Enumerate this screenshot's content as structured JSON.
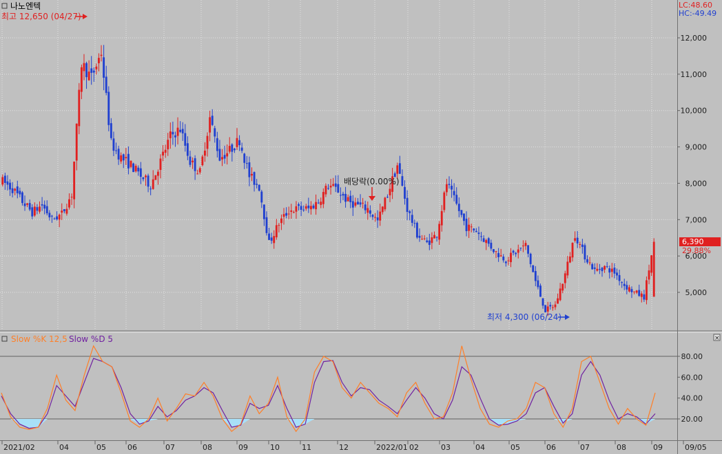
{
  "stock_name": "나노엔텍",
  "lc_label": "LC:48.60",
  "hc_label": "HC:-49.49",
  "high_annotation": "최고 12,650 (04/27)",
  "low_annotation": "최저 4,300 (06/24)",
  "ex_dividend_label": "배당락(0.00%)",
  "current_price_label": "6,390",
  "change_pct_label": "29.88%",
  "indicator_k_label": "Slow %K 12,5",
  "indicator_d_label": "Slow %D 5",
  "collapse_glyph": "×",
  "colors": {
    "up": "#e02020",
    "down": "#2040d0",
    "slow_k": "#ff7f27",
    "slow_d": "#7020a0",
    "oversold_fill": "#a8e0f8"
  },
  "chart_data": [
    {
      "type": "candlestick",
      "title": "나노엔텍",
      "y_ticks": [
        5000,
        6000,
        7000,
        8000,
        9000,
        10000,
        11000,
        12000
      ],
      "ylim": [
        4000,
        12900
      ],
      "x_ticks": [
        "2021/02",
        "04",
        "05",
        "06",
        "07",
        "08",
        "09",
        "10",
        "11",
        "12",
        "2022/01",
        "02",
        "03",
        "04",
        "05",
        "06",
        "07",
        "08",
        "09",
        "09/05"
      ],
      "approx_close_series": [
        8050,
        7850,
        7500,
        7200,
        7400,
        7000,
        7150,
        7700,
        11300,
        10900,
        11600,
        9100,
        8700,
        8500,
        8200,
        7950,
        8600,
        9300,
        9500,
        8600,
        8300,
        9800,
        8700,
        8900,
        9200,
        8200,
        7900,
        6350,
        6900,
        7250,
        7300,
        7300,
        7500,
        7950,
        7800,
        7500,
        7400,
        7300,
        6950,
        7700,
        8500,
        7300,
        6600,
        6350,
        6600,
        8000,
        7400,
        6800,
        6700,
        6400,
        6100,
        5900,
        6100,
        6300,
        5300,
        4500,
        4650,
        5500,
        6600,
        6000,
        5600,
        5700,
        5550,
        5200,
        5000,
        4880,
        6390
      ],
      "high": {
        "value": 12650,
        "date": "04/27"
      },
      "low": {
        "value": 4300,
        "date": "06/24"
      },
      "last": 6390,
      "change_pct": 29.88
    },
    {
      "type": "line",
      "title": "Slow %K 12,5 / Slow %D 5",
      "y_ticks": [
        20,
        40,
        60,
        80
      ],
      "ylim": [
        0,
        95
      ],
      "reference_lines": [
        20,
        80
      ],
      "series": [
        {
          "name": "Slow %K 12,5",
          "values": [
            45,
            22,
            12,
            10,
            12,
            30,
            62,
            38,
            28,
            62,
            90,
            75,
            70,
            45,
            18,
            12,
            20,
            40,
            18,
            30,
            44,
            42,
            55,
            42,
            20,
            8,
            15,
            42,
            25,
            35,
            60,
            22,
            8,
            20,
            65,
            80,
            75,
            50,
            40,
            55,
            45,
            35,
            30,
            22,
            45,
            55,
            35,
            20,
            22,
            45,
            90,
            58,
            30,
            15,
            12,
            18,
            20,
            30,
            55,
            50,
            25,
            12,
            30,
            75,
            80,
            55,
            30,
            15,
            30,
            20,
            14,
            45
          ]
        },
        {
          "name": "Slow %D 5",
          "values": [
            42,
            25,
            15,
            11,
            12,
            25,
            52,
            42,
            32,
            55,
            78,
            75,
            70,
            50,
            25,
            15,
            18,
            32,
            22,
            28,
            38,
            42,
            50,
            45,
            28,
            12,
            14,
            35,
            30,
            33,
            52,
            30,
            12,
            15,
            55,
            75,
            76,
            55,
            42,
            50,
            48,
            38,
            32,
            25,
            38,
            50,
            40,
            25,
            20,
            38,
            70,
            62,
            40,
            20,
            14,
            15,
            18,
            25,
            45,
            50,
            32,
            16,
            25,
            62,
            75,
            62,
            38,
            20,
            25,
            22,
            15,
            25
          ]
        }
      ],
      "lc": 48.6,
      "hc": -49.49
    }
  ]
}
